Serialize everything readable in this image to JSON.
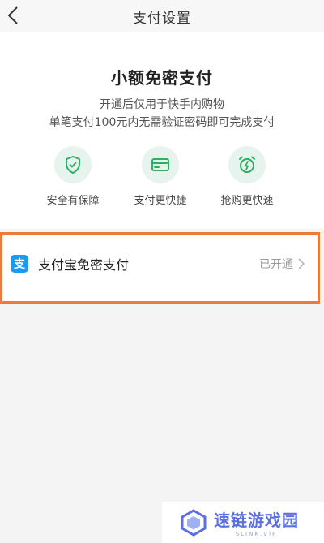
{
  "header": {
    "title": "支付设置",
    "back_icon": "chevron-left-icon"
  },
  "intro": {
    "title": "小额免密支付",
    "desc_line1": "开通后仅用于快手内购物",
    "desc_line2": "单笔支付100元内无需验证密码即可完成支付",
    "features": [
      {
        "label": "安全有保障",
        "icon": "shield-check-icon"
      },
      {
        "label": "支付更快捷",
        "icon": "card-icon"
      },
      {
        "label": "抢购更快速",
        "icon": "alarm-clock-icon"
      }
    ]
  },
  "payment_row": {
    "logo_glyph": "支",
    "label": "支付宝免密支付",
    "status": "已开通",
    "chevron_icon": "chevron-right-icon"
  },
  "watermark": {
    "name": "速链游戏园",
    "sub": "SLINK.VIP"
  },
  "colors": {
    "accent_green": "#2fae66",
    "icon_bg": "#e6f4ed",
    "highlight_border": "#ec7a3c",
    "alipay_blue": "#1a9bf0"
  }
}
